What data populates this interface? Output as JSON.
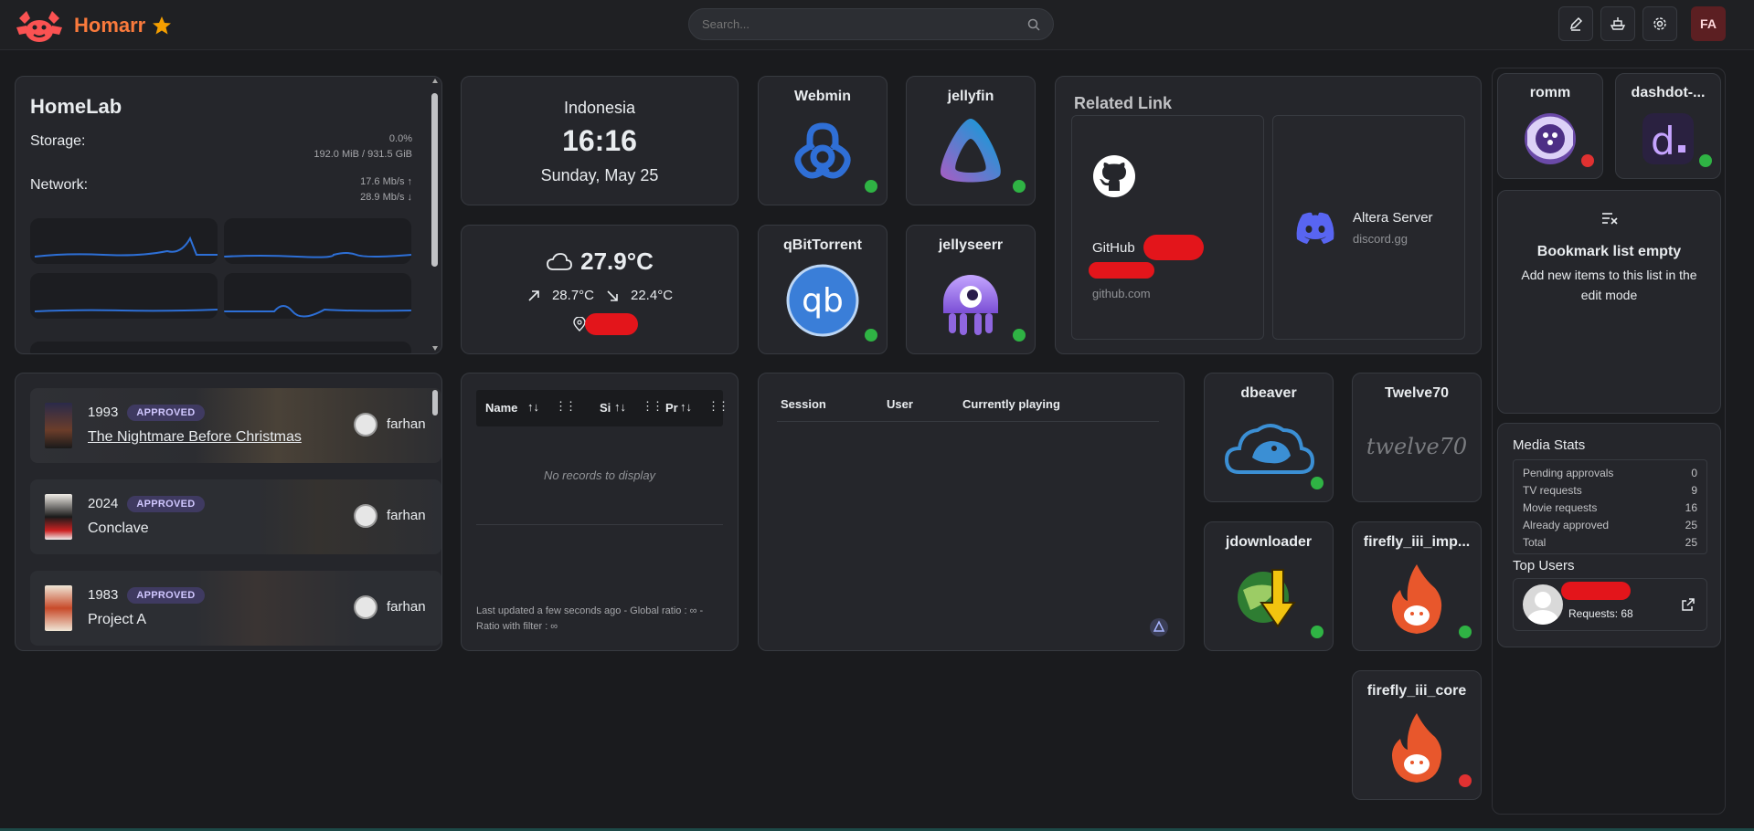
{
  "header": {
    "app_name": "Homarr",
    "search_placeholder": "Search...",
    "user_initials": "FA"
  },
  "homelab": {
    "title": "HomeLab",
    "storage_label": "Storage:",
    "storage_pct": "0.0%",
    "storage_used": "192.0 MiB / 931.5 GiB",
    "network_label": "Network:",
    "net_up": "17.6 Mb/s ↑",
    "net_down": "28.9 Mb/s ↓"
  },
  "clock": {
    "country": "Indonesia",
    "time": "16:16",
    "date": "Sunday, May 25"
  },
  "weather": {
    "temp": "27.9°C",
    "high": "28.7°C",
    "low": "22.4°C"
  },
  "apps": {
    "webmin": "Webmin",
    "jellyfin": "jellyfin",
    "qbittorrent": "qBitTorrent",
    "jellyseerr": "jellyseerr",
    "romm": "romm",
    "dashdot": "dashdot-...",
    "dbeaver": "dbeaver",
    "twelve70": "Twelve70",
    "twelve70_logo": "twelve70",
    "jdownloader": "jdownloader",
    "firefly_importer": "firefly_iii_imp...",
    "firefly_core": "firefly_iii_core"
  },
  "related": {
    "title": "Related Link",
    "github_name": "GitHub",
    "github_url": "github.com",
    "discord_name": "Altera Server",
    "discord_url": "discord.gg"
  },
  "bookmark": {
    "title": "Bookmark list empty",
    "text": "Add new items to this list in the edit mode"
  },
  "requests": [
    {
      "year": "1993",
      "status": "APPROVED",
      "title": "The Nightmare Before Christmas",
      "user": "farhan"
    },
    {
      "year": "2024",
      "status": "APPROVED",
      "title": "Conclave",
      "user": "farhan"
    },
    {
      "year": "1983",
      "status": "APPROVED",
      "title": "Project A",
      "user": "farhan"
    }
  ],
  "torrent": {
    "col_name": "Name",
    "col_size": "Si",
    "col_progress": "Pr",
    "empty": "No records to display",
    "footer": "Last updated a few seconds ago - Global ratio : ∞ - Ratio with filter : ∞"
  },
  "sessions": {
    "col_session": "Session",
    "col_user": "User",
    "col_playing": "Currently playing"
  },
  "media_stats": {
    "title": "Media Stats",
    "rows": [
      {
        "label": "Pending approvals",
        "value": "0"
      },
      {
        "label": "TV requests",
        "value": "9"
      },
      {
        "label": "Movie requests",
        "value": "16"
      },
      {
        "label": "Already approved",
        "value": "25"
      },
      {
        "label": "Total",
        "value": "25"
      }
    ],
    "top_users_title": "Top Users",
    "top_user_requests": "Requests: 68"
  },
  "colors": {
    "accent": "#fa7a3c",
    "online": "#2fb344",
    "offline": "#e03131",
    "badge": "#3f3a61"
  }
}
